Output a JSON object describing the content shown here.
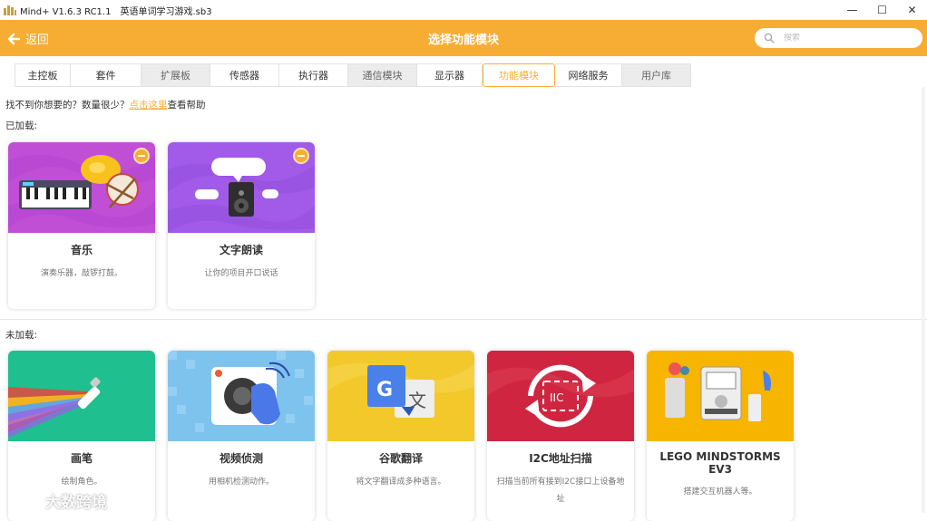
{
  "window": {
    "app_title": "Mind+ V1.6.3 RC1.1",
    "file_name": "英语单词学习游戏.sb3",
    "minimize": "—",
    "maximize": "☐",
    "close": "✕"
  },
  "header": {
    "back_label": "返回",
    "title": "选择功能模块",
    "search_placeholder": "搜索"
  },
  "tabs": [
    {
      "label": "主控板",
      "state": "normal"
    },
    {
      "label": "套件",
      "state": "normal"
    },
    {
      "label": "扩展板",
      "state": "grey"
    },
    {
      "label": "传感器",
      "state": "normal"
    },
    {
      "label": "执行器",
      "state": "normal"
    },
    {
      "label": "通信模块",
      "state": "grey"
    },
    {
      "label": "显示器",
      "state": "normal"
    },
    {
      "label": "功能模块",
      "state": "active"
    },
    {
      "label": "网络服务",
      "state": "normal"
    },
    {
      "label": "用户库",
      "state": "grey"
    }
  ],
  "help": {
    "prefix": "找不到你想要的？数量很少？",
    "link": "点击这里",
    "suffix": "查看帮助"
  },
  "loaded_label": "已加载:",
  "unloaded_label": "未加载:",
  "loaded": [
    {
      "name": "音乐",
      "desc": "演奏乐器，敲锣打鼓。",
      "icon": "music-keyboard-drum-icon",
      "color": "#c04fd6"
    },
    {
      "name": "文字朗读",
      "desc": "让你的项目开口说话",
      "icon": "speaker-speech-icon",
      "color": "#a15be8"
    }
  ],
  "unloaded": [
    {
      "name": "画笔",
      "desc": "绘制角色。",
      "icon": "pen-rainbow-icon",
      "color": "#1fbf8f"
    },
    {
      "name": "视频侦测",
      "desc": "用相机检测动作。",
      "icon": "camera-hand-icon",
      "color": "#6fb8e8"
    },
    {
      "name": "谷歌翻译",
      "desc": "将文字翻译成多种语言。",
      "icon": "google-translate-icon",
      "color": "#f3c82b"
    },
    {
      "name": "I2C地址扫描",
      "desc": "扫描当前所有接到I2C接口上设备地址",
      "icon": "i2c-scan-icon",
      "color": "#cf2541"
    },
    {
      "name": "LEGO MINDSTORMS EV3",
      "desc": "搭建交互机器人等。",
      "icon": "lego-ev3-icon",
      "color": "#f7b500"
    }
  ],
  "watermark": "大数跨境"
}
